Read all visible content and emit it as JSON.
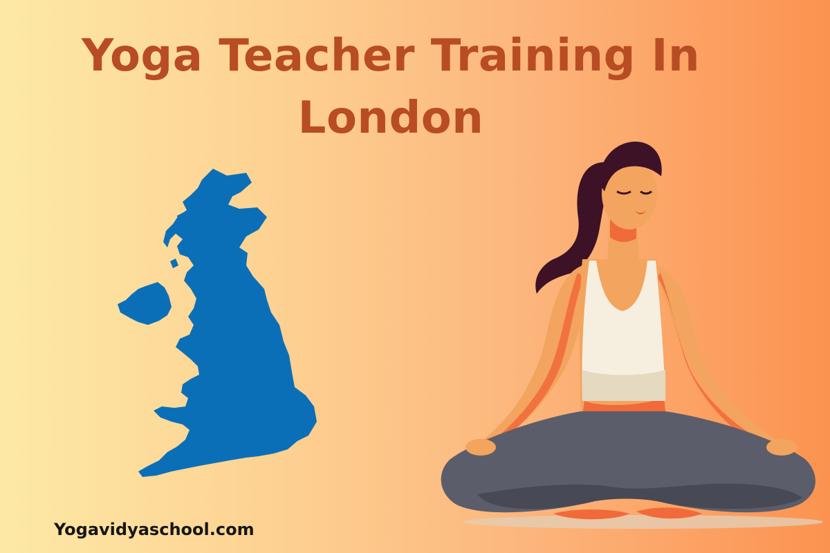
{
  "title": {
    "line1": "Yoga Teacher Training In",
    "line2": "London"
  },
  "footer": {
    "website": "Yogavidyaschool.com"
  },
  "colors": {
    "title": "#b84c22",
    "map": "#0b6fb8",
    "bg_left": "#fde9a6",
    "bg_right": "#fc9250"
  },
  "illustrations": {
    "map": "uk-map-icon",
    "figure": "meditating-woman-icon"
  }
}
